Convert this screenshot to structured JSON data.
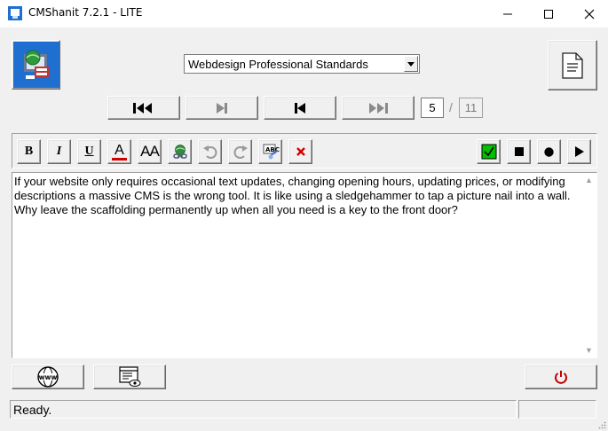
{
  "window": {
    "title": "CMShanit  7.2.1  -  LITE"
  },
  "template_select": {
    "selected": "Webdesign Professional Standards"
  },
  "navigation": {
    "current_page": "5",
    "separator": "/",
    "total_pages": "11"
  },
  "toolbar": {
    "bold": "B",
    "italic": "I",
    "underline": "U",
    "font_color": "A",
    "font_size": "AA"
  },
  "editor": {
    "content": "If your website only requires occasional text updates, changing opening hours, updating prices, or modifying descriptions a massive CMS is the wrong tool. It is like using a sledgehammer to tap a picture nail into a wall. Why leave the scaffolding permanently up when all you need is a key to the front door?"
  },
  "status": {
    "text": "Ready.",
    "side": ""
  },
  "colors": {
    "window_bg": "#f0f0f0",
    "accept_green": "#00c000",
    "delete_red": "#d00000",
    "power_red": "#c00000",
    "logo_blue": "#1e6fd0"
  },
  "icons": [
    "app-icon",
    "minimize-icon",
    "maximize-icon",
    "close-icon",
    "network-user-icon",
    "document-icon",
    "dropdown-arrow-icon",
    "first-record-icon",
    "next-record-icon",
    "previous-record-icon",
    "last-record-icon",
    "link-icon",
    "undo-icon",
    "redo-icon",
    "spellcheck-icon",
    "delete-icon",
    "accept-icon",
    "stop-icon",
    "record-icon",
    "play-icon",
    "www-icon",
    "preview-icon",
    "power-icon",
    "resize-grip-icon"
  ]
}
